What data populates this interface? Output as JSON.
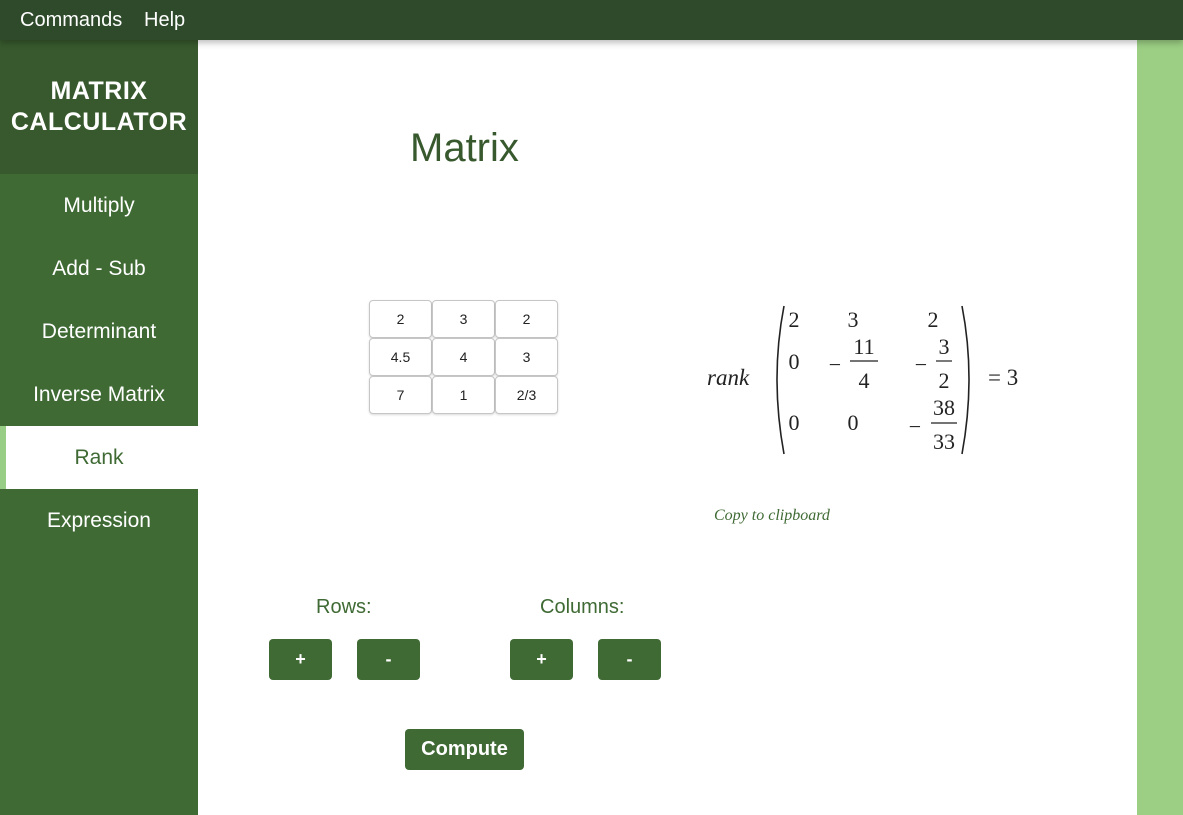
{
  "menubar": {
    "commands": "Commands",
    "help": "Help"
  },
  "sidebar": {
    "brand_line1": "MATRIX",
    "brand_line2": "CALCULATOR",
    "items": [
      {
        "label": "Multiply",
        "active": false
      },
      {
        "label": "Add - Sub",
        "active": false
      },
      {
        "label": "Determinant",
        "active": false
      },
      {
        "label": "Inverse Matrix",
        "active": false
      },
      {
        "label": "Rank",
        "active": true
      },
      {
        "label": "Expression",
        "active": false
      }
    ]
  },
  "main": {
    "title": "Matrix",
    "matrix": [
      [
        "2",
        "3",
        "2"
      ],
      [
        "4.5",
        "4",
        "3"
      ],
      [
        "7",
        "1",
        "2/3"
      ]
    ],
    "result": {
      "function_name": "rank",
      "rows": [
        [
          "2",
          "3",
          "2"
        ],
        [
          "0",
          "-11/4",
          "-3/2"
        ],
        [
          "0",
          "0",
          "-38/33"
        ]
      ],
      "equals": "= 3"
    },
    "copy_label": "Copy to clipboard",
    "rows_label": "Rows:",
    "columns_label": "Columns:",
    "plus": "+",
    "minus": "-",
    "compute": "Compute"
  },
  "colors": {
    "topbar": "#2e4a2a",
    "sidebar": "#3f6a34",
    "brand_bg": "#37592d",
    "accent_light": "#9ccf84"
  }
}
